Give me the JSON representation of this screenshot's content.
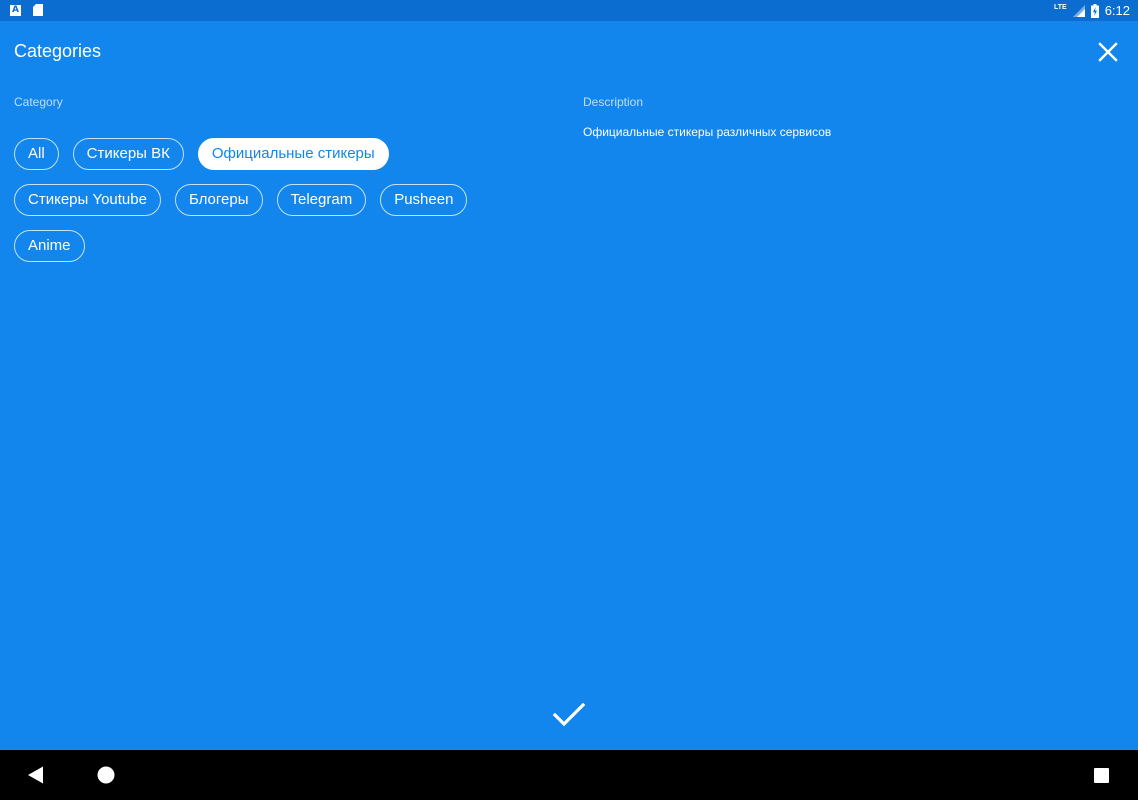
{
  "status_bar": {
    "time": "6:12",
    "network": "LTE",
    "icons": [
      "a-notification-icon",
      "sd-card-icon",
      "signal-icon",
      "battery-charging-icon"
    ]
  },
  "header": {
    "title": "Categories",
    "close_icon": "close-icon"
  },
  "category_section": {
    "label": "Category",
    "chips": [
      {
        "label": "All",
        "selected": false
      },
      {
        "label": "Стикеры ВК",
        "selected": false
      },
      {
        "label": "Официальные стикеры",
        "selected": true
      },
      {
        "label": "Стикеры Youtube",
        "selected": false
      },
      {
        "label": "Блогеры",
        "selected": false
      },
      {
        "label": "Telegram",
        "selected": false
      },
      {
        "label": "Pusheen",
        "selected": false
      },
      {
        "label": "Anime",
        "selected": false
      }
    ]
  },
  "description_section": {
    "label": "Description",
    "text": "Официальные стикеры различных сервисов"
  },
  "confirm_icon": "checkmark-icon",
  "nav_bar": {
    "icons": [
      "back-icon",
      "home-icon",
      "recents-icon"
    ]
  },
  "colors": {
    "background": "#1286ec",
    "status_bar": "#0c6dd0",
    "nav_bar": "#000000",
    "selected_chip_bg": "#ffffff",
    "selected_chip_text": "#1286ec"
  }
}
